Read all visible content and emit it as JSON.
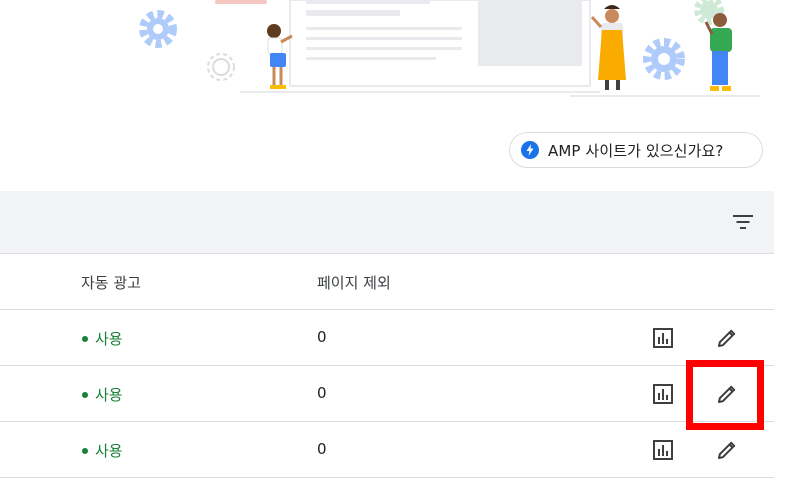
{
  "amp_chip": {
    "label": "AMP 사이트가 있으신가요?",
    "icon": "amp-bolt-icon",
    "accent_color": "#1a73e8"
  },
  "toolbar": {
    "filter_icon": "filter-list-icon"
  },
  "table": {
    "columns": [
      "자동 광고",
      "페이지 제외"
    ],
    "rows": [
      {
        "status": "사용",
        "excluded_pages": "0",
        "status_color": "#188038"
      },
      {
        "status": "사용",
        "excluded_pages": "0",
        "status_color": "#188038"
      },
      {
        "status": "사용",
        "excluded_pages": "0",
        "status_color": "#188038"
      }
    ],
    "row_icons": [
      "bar-chart-icon",
      "edit-pencil-icon"
    ]
  },
  "highlight": {
    "color": "#ff0000",
    "target": "row-2-edit-button"
  }
}
